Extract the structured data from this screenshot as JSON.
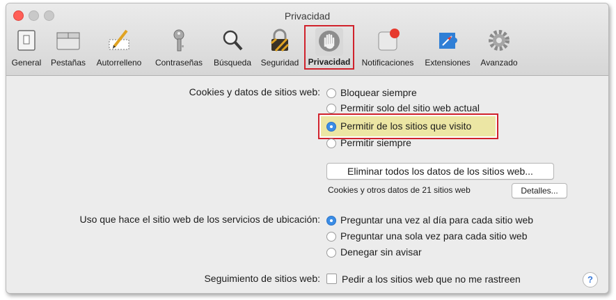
{
  "window": {
    "title": "Privacidad"
  },
  "toolbar": {
    "items": [
      {
        "label": "General",
        "icon": "general-icon"
      },
      {
        "label": "Pestañas",
        "icon": "tabs-icon"
      },
      {
        "label": "Autorrelleno",
        "icon": "autofill-pencil-icon"
      },
      {
        "label": "Contraseñas",
        "icon": "key-icon"
      },
      {
        "label": "Búsqueda",
        "icon": "magnifier-icon"
      },
      {
        "label": "Seguridad",
        "icon": "lock-icon"
      },
      {
        "label": "Privacidad",
        "icon": "hand-icon",
        "selected": true
      },
      {
        "label": "Notificaciones",
        "icon": "notifications-icon"
      },
      {
        "label": "Extensiones",
        "icon": "extensions-icon"
      },
      {
        "label": "Avanzado",
        "icon": "gear-icon"
      }
    ]
  },
  "cookies": {
    "label": "Cookies y datos de sitios web:",
    "options": [
      "Bloquear siempre",
      "Permitir solo del sitio web actual",
      "Permitir de los sitios que visito",
      "Permitir siempre"
    ],
    "selected": 2,
    "remove_button": "Eliminar todos los datos de los sitios web...",
    "summary": "Cookies y otros datos de 21 sitios web",
    "details_button": "Detalles..."
  },
  "location": {
    "label": "Uso que hace el sitio web de los servicios de ubicación:",
    "options": [
      "Preguntar una vez al día para cada sitio web",
      "Preguntar una sola vez para cada sitio web",
      "Denegar sin avisar"
    ],
    "selected": 0
  },
  "tracking": {
    "label": "Seguimiento de sitios web:",
    "checkbox_label": "Pedir a los sitios web que no me rastreen",
    "checked": false
  },
  "help": {
    "label": "?"
  },
  "colors": {
    "accent": "#3b8de6",
    "highlight_border": "#d0212b",
    "highlight_fill": "#ece6a4"
  }
}
